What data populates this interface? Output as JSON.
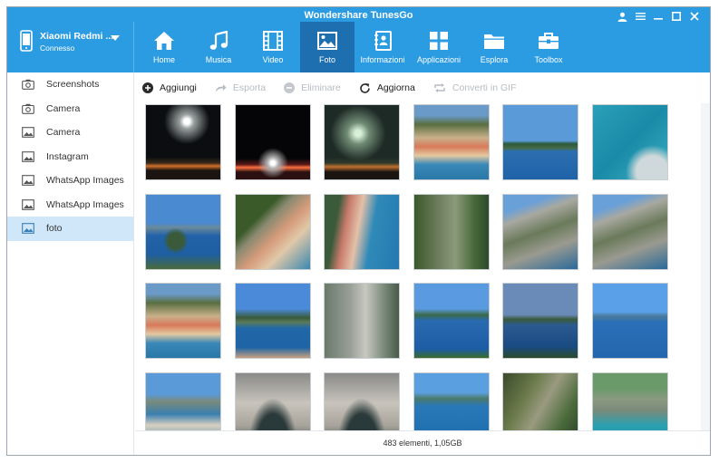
{
  "app": {
    "title": "Wondershare TunesGo"
  },
  "device": {
    "name": "Xiaomi Redmi ...",
    "status": "Connesso"
  },
  "nav": [
    {
      "label": "Home",
      "icon": "home-icon"
    },
    {
      "label": "Musica",
      "icon": "music-note-icon"
    },
    {
      "label": "Video",
      "icon": "film-icon"
    },
    {
      "label": "Foto",
      "icon": "photo-icon",
      "active": true
    },
    {
      "label": "Informazioni",
      "icon": "contacts-book-icon"
    },
    {
      "label": "Applicazioni",
      "icon": "apps-grid-icon"
    },
    {
      "label": "Esplora",
      "icon": "folder-icon"
    },
    {
      "label": "Toolbox",
      "icon": "toolbox-icon"
    }
  ],
  "sidebar": {
    "items": [
      {
        "label": "Screenshots",
        "icon": "camera-icon"
      },
      {
        "label": "Camera",
        "icon": "camera-icon"
      },
      {
        "label": "Camera",
        "icon": "image-icon"
      },
      {
        "label": "Instagram",
        "icon": "image-icon"
      },
      {
        "label": "WhatsApp Images",
        "icon": "image-icon"
      },
      {
        "label": "WhatsApp Images",
        "icon": "image-icon"
      },
      {
        "label": "foto",
        "icon": "image-icon",
        "active": true
      }
    ]
  },
  "toolbar": {
    "add": "Aggiungi",
    "export": "Esporta",
    "delete": "Eliminare",
    "refresh": "Aggiorna",
    "convert": "Converti in GIF"
  },
  "photos": [
    "fireworks",
    "fireworks-night",
    "fireworks-green",
    "beach-umbrellas",
    "coast-bay",
    "turquoise-water",
    "island-sea",
    "beach-cliff",
    "beach-shore",
    "cave-rock",
    "rocky-cliff",
    "rocky-cliff",
    "beach-umbrellas",
    "coast-hills",
    "sea-cave",
    "bay-island",
    "coast-dusk",
    "island-bay",
    "shore-mountain",
    "cave-arch",
    "cave-arch",
    "bay-rocks",
    "cliff-plants",
    "rocky-cove"
  ],
  "colors": {
    "header": "#2b9be2",
    "nav_active": "#1e6fb0",
    "sidebar_active": "#cfe7f8"
  },
  "status": "483 elementi, 1,05GB"
}
